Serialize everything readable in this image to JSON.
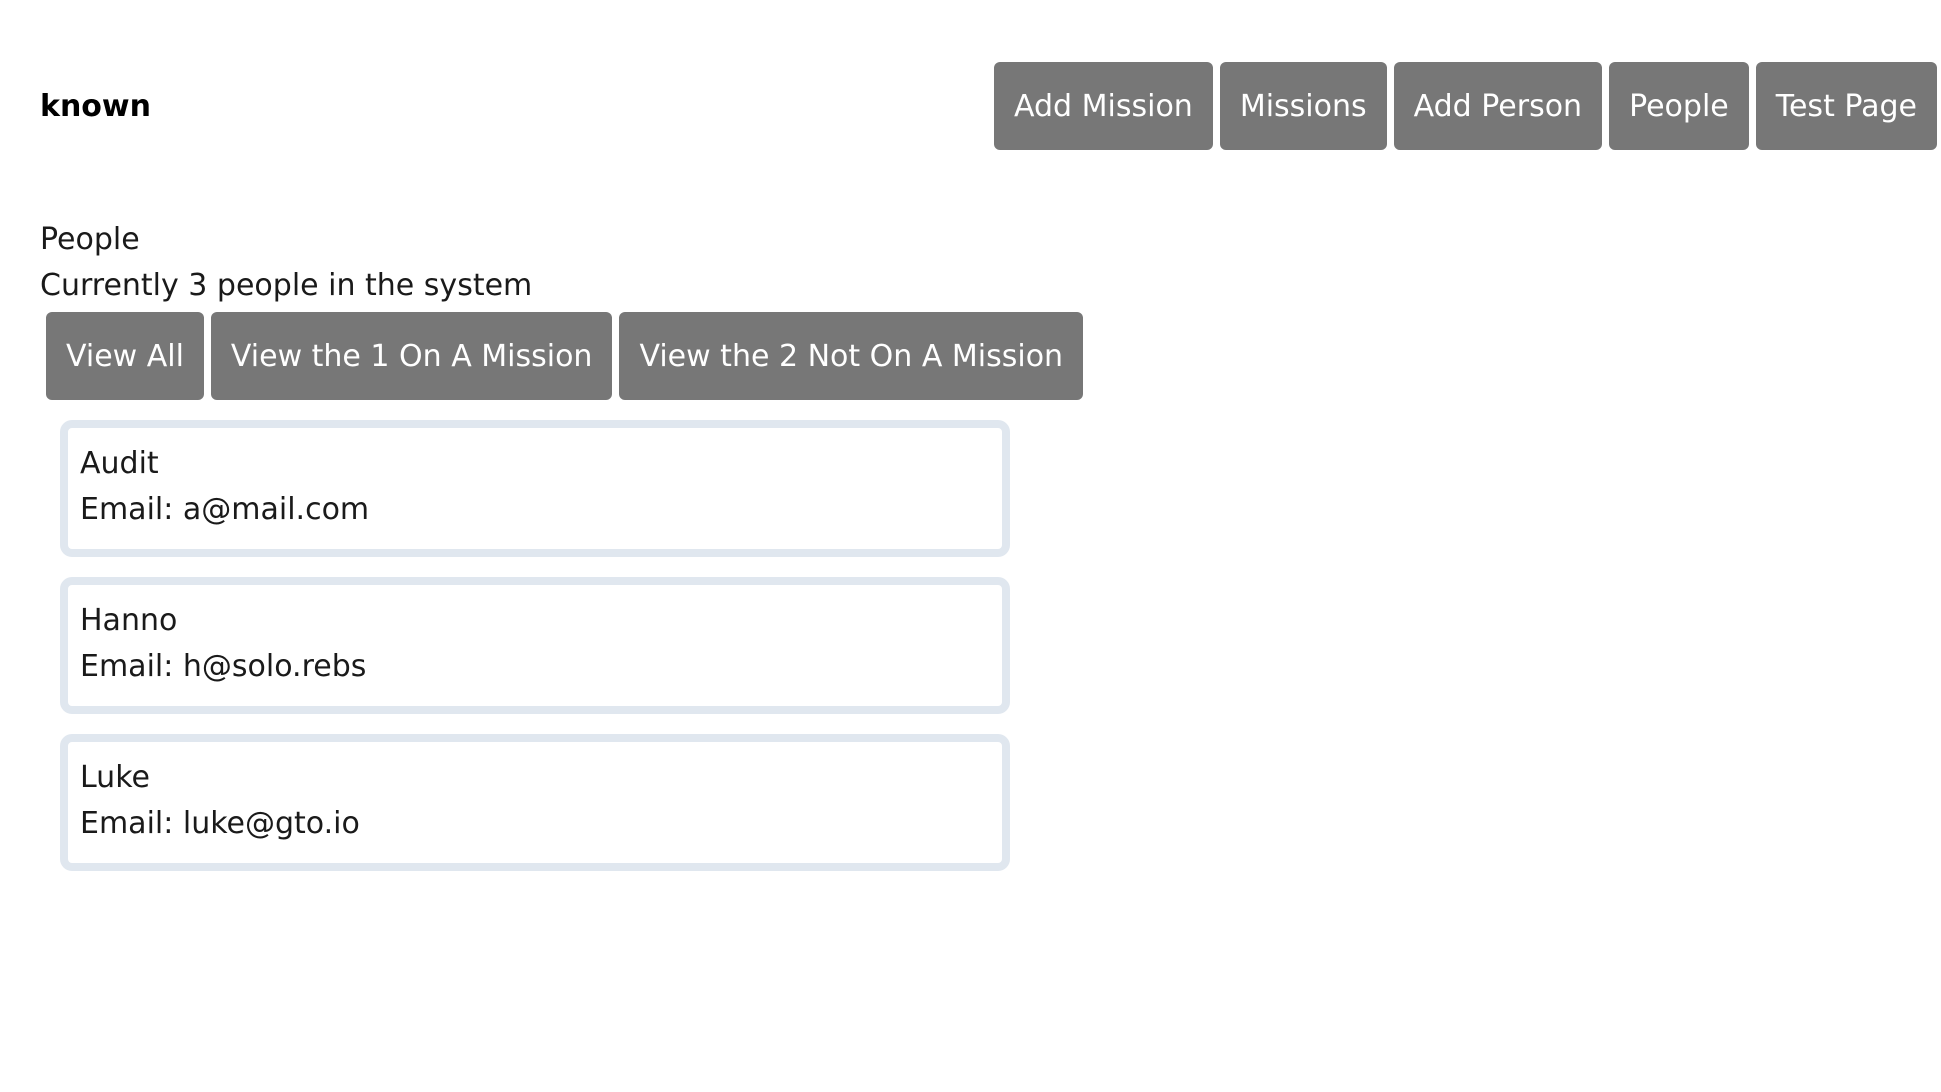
{
  "header": {
    "brand": "known",
    "nav": [
      {
        "label": "Add Mission"
      },
      {
        "label": "Missions"
      },
      {
        "label": "Add Person"
      },
      {
        "label": "People"
      },
      {
        "label": "Test Page"
      }
    ]
  },
  "main": {
    "title": "People",
    "count_text": "Currently 3 people in the system",
    "filters": [
      {
        "label": "View All"
      },
      {
        "label": "View the 1 On A Mission"
      },
      {
        "label": "View the 2 Not On A Mission"
      }
    ],
    "people": [
      {
        "name": "Audit",
        "email": "Email: a@mail.com"
      },
      {
        "name": "Hanno",
        "email": "Email: h@solo.rebs"
      },
      {
        "name": "Luke",
        "email": "Email: luke@gto.io"
      }
    ]
  },
  "colors": {
    "button_bg": "#777777",
    "button_text": "#ffffff",
    "card_border": "#e0e7ef"
  }
}
